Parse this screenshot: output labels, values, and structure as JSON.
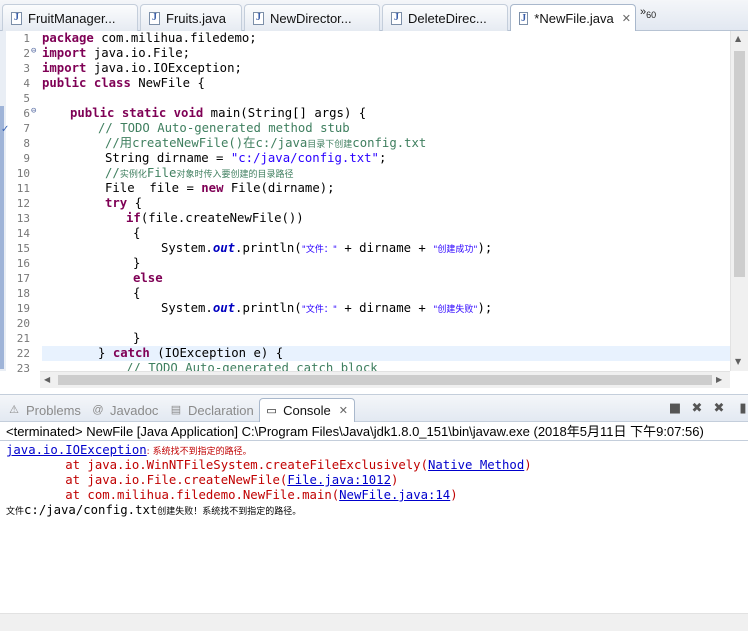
{
  "editor_tabs": [
    {
      "label": "FruitManager..."
    },
    {
      "label": "Fruits.java"
    },
    {
      "label": "NewDirector..."
    },
    {
      "label": "DeleteDirec..."
    },
    {
      "label": "*NewFile.java"
    }
  ],
  "overflow": {
    "symbol": "»",
    "count": "60"
  },
  "line_numbers": [
    "1",
    "2",
    "3",
    "4",
    "5",
    "6",
    "7",
    "8",
    "9",
    "10",
    "11",
    "12",
    "13",
    "14",
    "15",
    "16",
    "17",
    "18",
    "19",
    "20",
    "21",
    "22",
    "23"
  ],
  "code": {
    "l1": {
      "kw": "package",
      "rest": " com.milihua.filedemo;"
    },
    "l2": {
      "kw": "import",
      "rest": " java.io.File;"
    },
    "l3": {
      "kw": "import",
      "rest": " java.io.IOException;"
    },
    "l4": {
      "kw1": "public",
      "kw2": "class",
      "rest": " NewFile {"
    },
    "l6": {
      "kw1": "public",
      "kw2": "static",
      "kw3": "void",
      "rest": " main(String[] args) {"
    },
    "l7": {
      "comment": "// TODO Auto-generated method stub"
    },
    "l8": {
      "c1": "//用createNewFile()在c:/java",
      "c2": "目录下创建",
      "c3": "config.txt"
    },
    "l9": {
      "pre": "String ",
      "var": "dirname",
      "eq": " = ",
      "str": "\"c:/java/config.txt\"",
      "end": ";"
    },
    "l10": {
      "c1": "//",
      "c2": "实例化",
      "c3": "File",
      "c4": "对象时传入要创建的目录路径"
    },
    "l11": {
      "pre": "File  ",
      "var": "file",
      "eq": " = ",
      "kw": "new",
      "rest": " File(dirname);"
    },
    "l12": {
      "kw": "try",
      "rest": " {"
    },
    "l13": {
      "kw": "if",
      "rest": "(file.createNewFile())"
    },
    "l14": {
      "text": "{"
    },
    "l15": {
      "pre": "System.",
      "field": "out",
      "mid": ".println(",
      "s1": "\"文件：\"",
      "plus1": " + dirname + ",
      "s2": "\"创建成功\"",
      "end": ");"
    },
    "l16": {
      "text": "}"
    },
    "l17": {
      "kw": "else"
    },
    "l18": {
      "text": "{"
    },
    "l19": {
      "pre": "System.",
      "field": "out",
      "mid": ".println(",
      "s1": "\"文件：\"",
      "plus1": " + dirname + ",
      "s2": "\"创建失败\"",
      "end": ");"
    },
    "l21": {
      "text": "}"
    },
    "l22": {
      "pre": "} ",
      "kw": "catch",
      "rest": " (IOException e) {"
    },
    "l23": {
      "comment": "// TODO Auto-generated catch block"
    }
  },
  "view_tabs": [
    {
      "label": "Problems",
      "icon": "problems-icon"
    },
    {
      "label": "Javadoc",
      "icon": "at-icon"
    },
    {
      "label": "Declaration",
      "icon": "declaration-icon"
    },
    {
      "label": "Console",
      "icon": "console-icon"
    }
  ],
  "status": "<terminated> NewFile [Java Application] C:\\Program Files\\Java\\jdk1.8.0_151\\bin\\javaw.exe (2018年5月11日 下午9:07:56)",
  "console": {
    "exc_class": "java.io.IOException",
    "exc_msg": ": 系统找不到指定的路径。",
    "t1_pre": "        at java.io.WinNTFileSystem.createFileExclusively(",
    "t1_link": "Native Method",
    "t2_pre": "        at java.io.File.createNewFile(",
    "t2_link": "File.java:1012",
    "t3_pre": "        at com.milihua.filedemo.NewFile.main(",
    "t3_link": "NewFile.java:14",
    "paren": ")",
    "out_a": "文件",
    "out_b": "c:/java/config.txt",
    "out_c": "创建失败！系统找不到指定的路径。"
  }
}
